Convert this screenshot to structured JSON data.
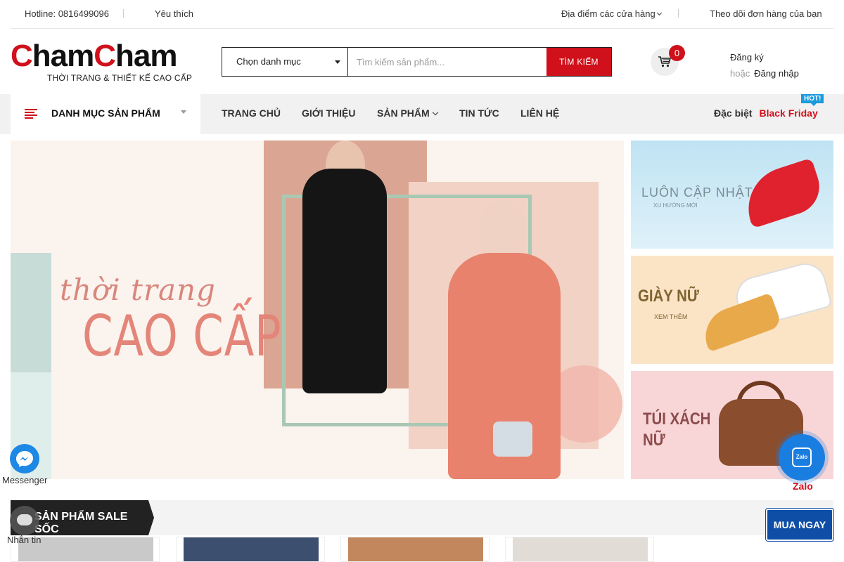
{
  "topbar": {
    "hotline": "Hotline: 0816499096",
    "wishlist": "Yêu thích",
    "stores": "Địa điểm các cửa hàng",
    "track_order": "Theo dõi đơn hàng của bạn"
  },
  "logo": {
    "brand_c1": "C",
    "brand_rest1": "ham",
    "brand_c2": "C",
    "brand_rest2": "ham",
    "tagline": "THỜI TRANG & THIẾT KẾ CAO CẤP"
  },
  "search": {
    "category_label": "Chọn danh mục",
    "placeholder": "Tìm kiếm sản phẩm...",
    "button": "TÌM KIẾM"
  },
  "cart": {
    "count": "0",
    "icon": "cart-icon"
  },
  "account": {
    "register": "Đăng ký",
    "or": "hoặc",
    "login": "Đăng nhập"
  },
  "nav": {
    "categories_label": "DANH MỤC SẢN PHẨM",
    "items": [
      {
        "label": "TRANG CHỦ"
      },
      {
        "label": "GIỚI THIỆU"
      },
      {
        "label": "SẢN PHẨM"
      },
      {
        "label": "TIN TỨC"
      },
      {
        "label": "LIÊN HỆ"
      }
    ],
    "special_label": "Đặc biệt",
    "black_friday": "Black Friday",
    "hot_badge": "HOT!"
  },
  "hero": {
    "script_text": "thời trang",
    "headline": "CAO CẤP"
  },
  "side_banners": [
    {
      "title": "LUÔN CẬP NHẬT",
      "sub": "XU HƯỚNG MỚI"
    },
    {
      "title": "GIÀY NỮ",
      "sub": "XEM THÊM"
    },
    {
      "title_line1": "TÚI XÁCH",
      "title_line2": "NỮ"
    }
  ],
  "sale_section": {
    "title": "SẢN PHẨM SALE SỐC"
  },
  "widgets": {
    "messenger": "Messenger",
    "chat": "Nhắn tin",
    "zalo": "Zalo",
    "zalo_icon_text": "Zalo",
    "buy_now": "MUA NGAY"
  },
  "colors": {
    "brand_red": "#d0101a",
    "accent_blue": "#0f4ea6",
    "hot_blue": "#1a9bdc"
  }
}
